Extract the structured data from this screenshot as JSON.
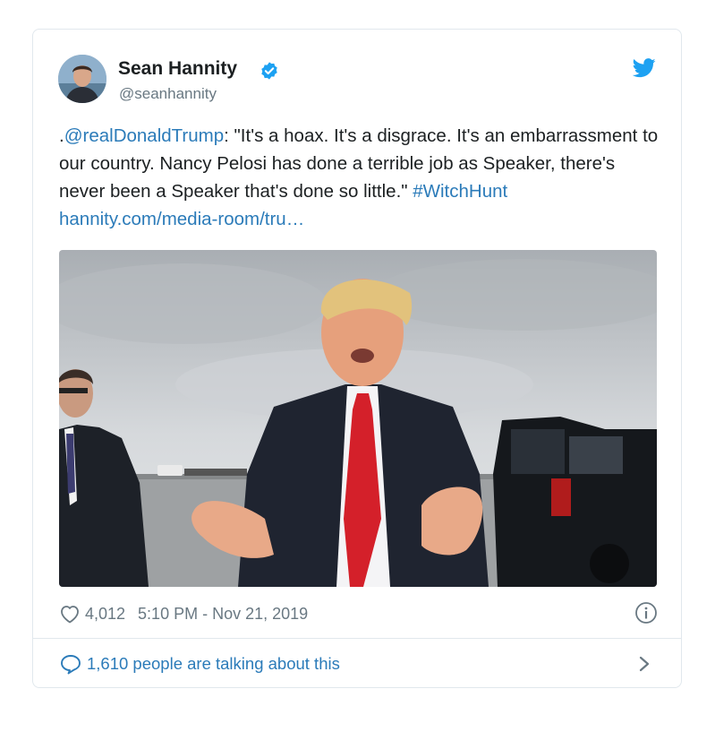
{
  "author": {
    "name": "Sean Hannity",
    "handle": "@seanhannity"
  },
  "tweet": {
    "prefix": ".",
    "mention": "@realDonaldTrump",
    "body": ": \"It's a hoax. It's a disgrace. It's an embarrassment to our country. Nancy Pelosi has done a terrible job as Speaker, there's never been a Speaker that's done so little.\" ",
    "hashtag": "#WitchHunt",
    "url": "hannity.com/media-room/tru…"
  },
  "meta": {
    "likes": "4,012",
    "timestamp": "5:10 PM - Nov 21, 2019"
  },
  "conversation": {
    "label": "1,610 people are talking about this"
  },
  "colors": {
    "link": "#2b7bb9",
    "twitter_blue": "#1da1f2",
    "muted": "#697882",
    "border": "#e1e8ed"
  },
  "icons": {
    "verified": "verified-badge-icon",
    "brand": "twitter-bird-icon",
    "like": "heart-icon",
    "info": "info-icon",
    "reply": "speech-bubble-icon",
    "more": "chevron-right-icon"
  }
}
